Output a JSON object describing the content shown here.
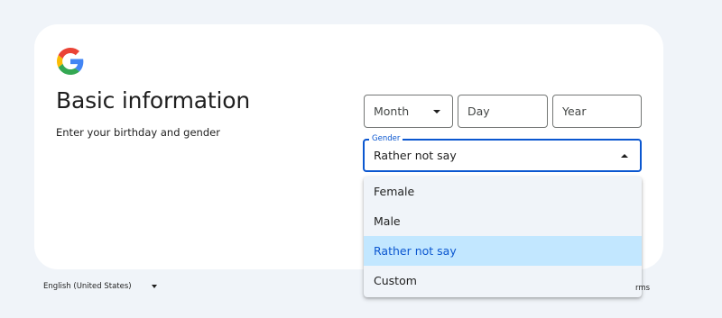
{
  "header": {
    "logo_icon": "google-g-logo",
    "title": "Basic information",
    "subtitle": "Enter your birthday and gender"
  },
  "birthday": {
    "month_label": "Month",
    "day_label": "Day",
    "year_label": "Year"
  },
  "gender": {
    "legend": "Gender",
    "selected_value": "Rather not say",
    "options": [
      "Female",
      "Male",
      "Rather not say",
      "Custom"
    ],
    "selected_index": 2
  },
  "footer": {
    "language": "English (United States)",
    "terms_partial": "rms"
  },
  "colors": {
    "background": "#f0f4f9",
    "card": "#ffffff",
    "accent": "#0b57d0",
    "selected_option_bg": "#c2e7ff",
    "menu_bg": "#f0f4f9"
  }
}
